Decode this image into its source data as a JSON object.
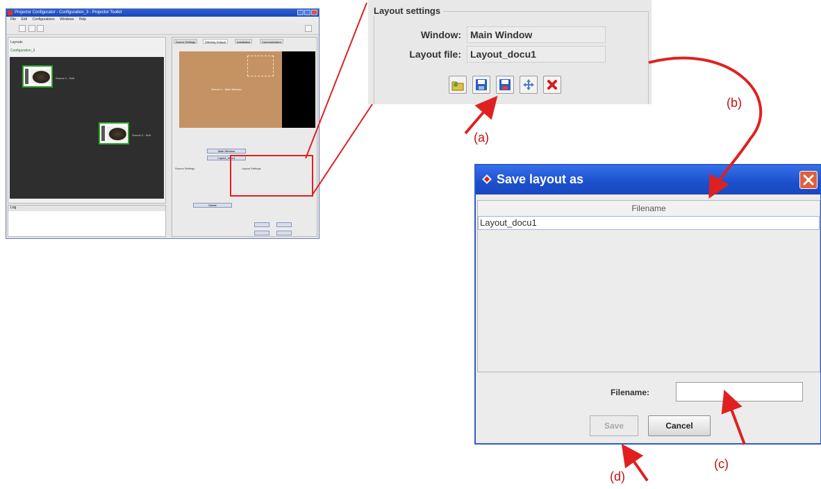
{
  "app": {
    "title": "Projector Configurator - Configuration_3 - Projector Toolkit",
    "menu": [
      "File",
      "Edit",
      "Configurations",
      "Windows",
      "Help"
    ],
    "left_tab": "Layouts",
    "configuration": "Configuration_3",
    "sources": [
      "Source 1 - Soft",
      "Source 2 - Soft"
    ],
    "log_header": "Log",
    "right_tabs": [
      "Source Settings",
      "Stitching Hotspot",
      "Installation",
      "Communication"
    ],
    "preview_text": "Source 1 - Main Window",
    "section_labels": [
      "Source Settings",
      "Layout Settings"
    ],
    "window_value": "Main Window",
    "layout_value": "Layout_docu1",
    "delete_label": "Delete"
  },
  "zoom": {
    "legend": "Layout settings",
    "window_label": "Window:",
    "window_value": "Main Window",
    "layout_label": "Layout file:",
    "layout_value": "Layout_docu1",
    "buttons": [
      "open-folder-icon",
      "save-icon",
      "save-as-icon",
      "move-icon",
      "delete-icon"
    ]
  },
  "dialog": {
    "title": "Save layout as",
    "column_header": "Filename",
    "rows": [
      "Layout_docu1"
    ],
    "filename_label": "Filename:",
    "filename_value": "",
    "save_label": "Save",
    "cancel_label": "Cancel"
  },
  "callouts": {
    "a": "(a)",
    "b": "(b)",
    "c": "(c)",
    "d": "(d)"
  },
  "colors": {
    "annotation": "#e02020",
    "titlebar": "#1c4fcd",
    "thumb_border": "#2ea82e"
  }
}
